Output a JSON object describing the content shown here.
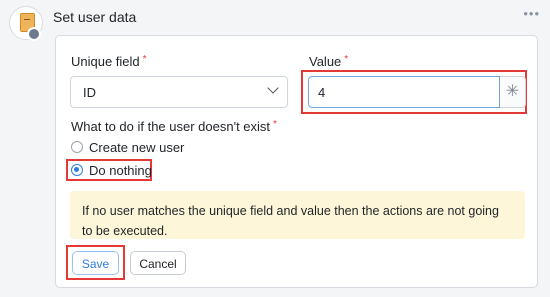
{
  "header": {
    "title": "Set user data",
    "menu_icon": "more-dots-icon",
    "menu_glyph": "•••"
  },
  "form": {
    "unique_field_label": "Unique field",
    "unique_field_value": "ID",
    "value_label": "Value",
    "value_input": "4",
    "value_side_glyph": "✳",
    "required_mark": "*",
    "nonexistent_label": "What to do if the user doesn't exist",
    "options": [
      {
        "label": "Create new user",
        "checked": false
      },
      {
        "label": "Do nothing",
        "checked": true
      }
    ],
    "notice": "If no user matches the unique field and value then the actions are not going to be executed."
  },
  "buttons": {
    "save": "Save",
    "cancel": "Cancel"
  },
  "colors": {
    "accent": "#2f7de1",
    "highlight": "#e53935",
    "notice_bg": "#fdf6d8"
  }
}
